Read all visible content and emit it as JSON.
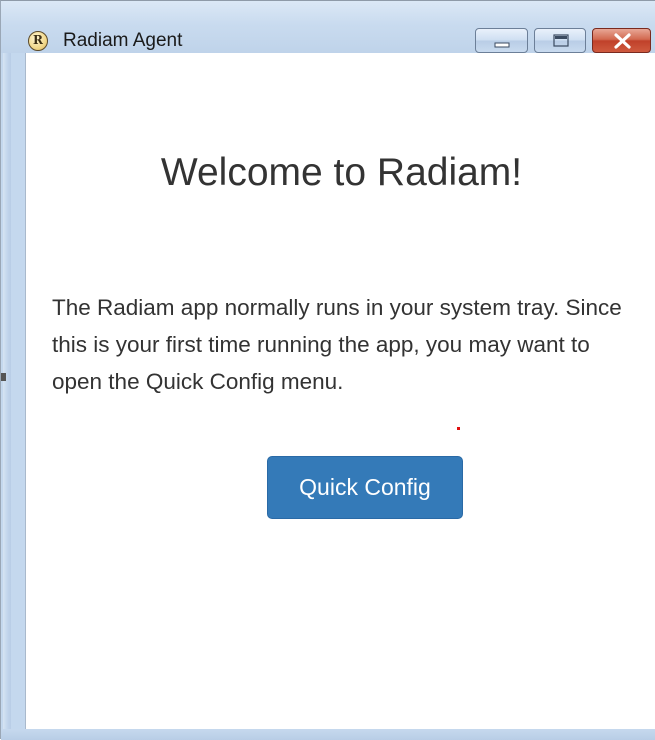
{
  "window": {
    "title": "Radiam Agent",
    "icon": "radiam-logo-icon",
    "icon_letter": "R",
    "controls": [
      "minimize-icon",
      "maximize-icon",
      "close-icon"
    ]
  },
  "main": {
    "heading": "Welcome to Radiam!",
    "description": "The Radiam app normally runs in your system tray. Since this is your first time running the app, you may want to open the Quick Config menu.",
    "quick_config_label": "Quick Config"
  },
  "colors": {
    "primary_button": "#347ab8",
    "titlebar": "#c9dbef",
    "close_button": "#c0412a",
    "text": "#333333"
  }
}
